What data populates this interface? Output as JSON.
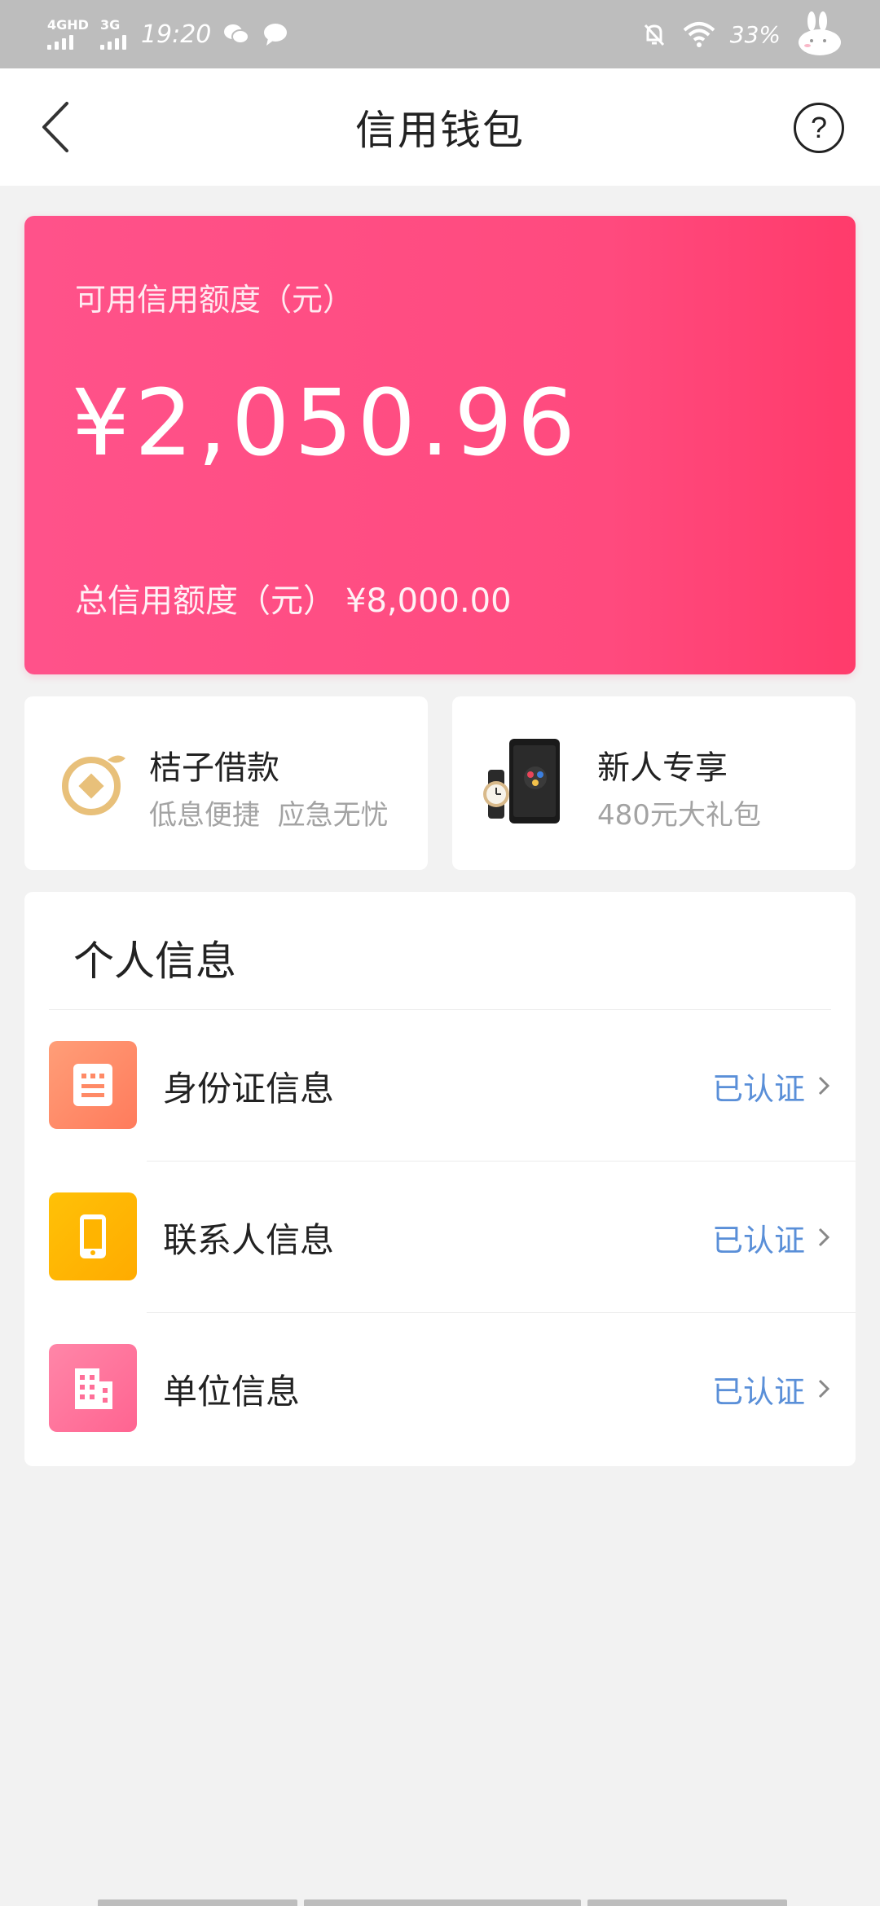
{
  "status_bar": {
    "network1": "4GHD",
    "network2": "3G",
    "time": "19:20",
    "battery": "33%"
  },
  "header": {
    "title": "信用钱包",
    "help_symbol": "?"
  },
  "credit": {
    "available_label": "可用信用额度（元）",
    "available_amount": "¥2,050.96",
    "total_label": "总信用额度（元）",
    "total_amount": "¥8,000.00"
  },
  "promos": [
    {
      "title": "桔子借款",
      "subtitle": "低息便捷  应急无忧"
    },
    {
      "title": "新人专享",
      "subtitle": "480元大礼包"
    }
  ],
  "personal_info": {
    "title": "个人信息",
    "items": [
      {
        "label": "身份证信息",
        "status": "已认证",
        "icon": "id-card-icon",
        "color": "#ff8f6a"
      },
      {
        "label": "联系人信息",
        "status": "已认证",
        "icon": "phone-icon",
        "color": "#ffb800"
      },
      {
        "label": "单位信息",
        "status": "已认证",
        "icon": "building-icon",
        "color": "#ff6f98"
      }
    ]
  },
  "colors": {
    "card_pink": "#ff4a7e",
    "verified_blue": "#5a8fd8",
    "background": "#f2f2f2"
  }
}
